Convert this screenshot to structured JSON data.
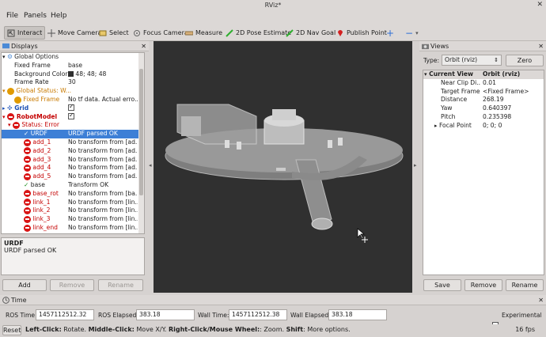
{
  "window": {
    "title": "RViz*"
  },
  "menu": {
    "file": "File",
    "panels": "Panels",
    "help": "Help"
  },
  "toolbar": {
    "interact": "Interact",
    "move_camera": "Move Camera",
    "select": "Select",
    "focus_camera": "Focus Camera",
    "measure": "Measure",
    "pose_estimate": "2D Pose Estimate",
    "nav_goal": "2D Nav Goal",
    "publish_point": "Publish Point",
    "plus": "+",
    "minus": "−"
  },
  "displays": {
    "title": "Displays",
    "rows": [
      {
        "k": "Global Options",
        "v": ""
      },
      {
        "k": "Fixed Frame",
        "v": "base"
      },
      {
        "k": "Background Color",
        "v": "48; 48; 48"
      },
      {
        "k": "Frame Rate",
        "v": "30"
      },
      {
        "k": "Global Status: W...",
        "v": ""
      },
      {
        "k": "Fixed Frame",
        "v": "No tf data.  Actual erro..."
      },
      {
        "k": "Grid",
        "v": ""
      },
      {
        "k": "RobotModel",
        "v": ""
      },
      {
        "k": "Status: Error",
        "v": ""
      },
      {
        "k": "URDF",
        "v": "URDF parsed OK"
      },
      {
        "k": "add_1",
        "v": "No transform from [ad..."
      },
      {
        "k": "add_2",
        "v": "No transform from [ad..."
      },
      {
        "k": "add_3",
        "v": "No transform from [ad..."
      },
      {
        "k": "add_4",
        "v": "No transform from [ad..."
      },
      {
        "k": "add_5",
        "v": "No transform from [ad..."
      },
      {
        "k": "base",
        "v": "Transform OK"
      },
      {
        "k": "base_rot",
        "v": "No transform from [ba..."
      },
      {
        "k": "link_1",
        "v": "No transform from [lin..."
      },
      {
        "k": "link_2",
        "v": "No transform from [lin..."
      },
      {
        "k": "link_3",
        "v": "No transform from [lin..."
      },
      {
        "k": "link_end",
        "v": "No transform from [lin..."
      }
    ],
    "description_title": "URDF",
    "description_text": "URDF parsed OK",
    "add": "Add",
    "remove": "Remove",
    "rename": "Rename"
  },
  "views": {
    "title": "Views",
    "type_label": "Type:",
    "type_value": "Orbit (rviz)",
    "zero": "Zero",
    "current_view": "Current View",
    "current_view_value": "Orbit (rviz)",
    "props": [
      {
        "k": "Near Clip Di...",
        "v": "0.01"
      },
      {
        "k": "Target Frame",
        "v": "<Fixed Frame>"
      },
      {
        "k": "Distance",
        "v": "268.19"
      },
      {
        "k": "Yaw",
        "v": "0.640397"
      },
      {
        "k": "Pitch",
        "v": "0.235398"
      },
      {
        "k": "Focal Point",
        "v": "0; 0; 0"
      }
    ],
    "save": "Save",
    "remove": "Remove",
    "rename": "Rename"
  },
  "time": {
    "title": "Time",
    "ros_time_label": "ROS Time:",
    "ros_time": "1457112512.32",
    "ros_elapsed_label": "ROS Elapsed:",
    "ros_elapsed": "383.18",
    "wall_time_label": "Wall Time:",
    "wall_time": "1457112512.38",
    "wall_elapsed_label": "Wall Elapsed:",
    "wall_elapsed": "383.18",
    "experimental": "Experimental"
  },
  "status": {
    "reset": "Reset",
    "hint_bold1": "Left-Click:",
    "hint1": " Rotate. ",
    "hint_bold2": "Middle-Click:",
    "hint2": " Move X/Y. ",
    "hint_bold3": "Right-Click/Mouse Wheel:",
    "hint3": ": Zoom. ",
    "hint_bold4": "Shift",
    "hint4": ": More options.",
    "fps": "16 fps"
  },
  "colors": {
    "background": "#303030",
    "selection": "#3d7fd6",
    "error": "#c40000"
  }
}
